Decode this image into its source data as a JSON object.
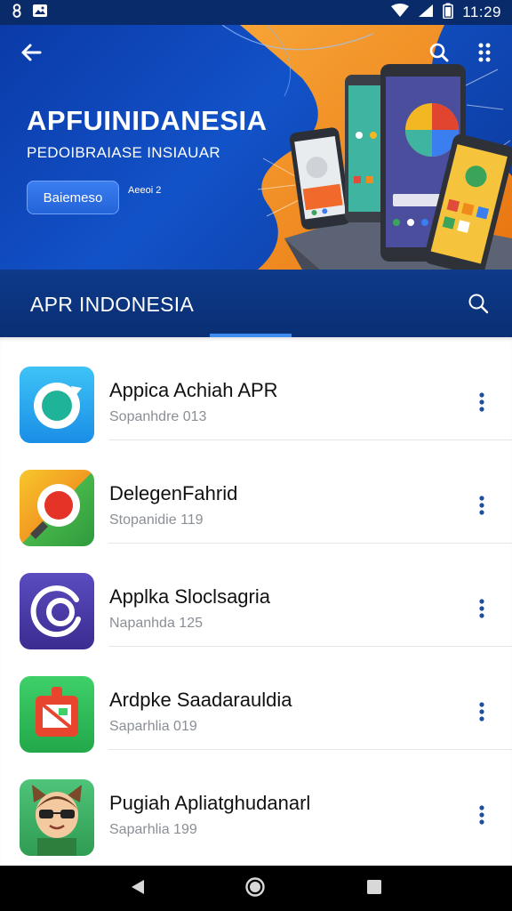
{
  "status_bar": {
    "time": "11:29",
    "left_icons": [
      "notification-8-icon",
      "image-notification-icon"
    ],
    "right_icons": [
      "wifi-icon",
      "signal-icon",
      "battery-icon"
    ]
  },
  "hero": {
    "title": "APFUINIDANESIA",
    "subtitle": "PEDOIBRAIASE INSIAUAR",
    "button_label": "Baiemeso",
    "small_text": "Aeeoi 2",
    "icons": [
      "back-arrow-icon",
      "search-icon",
      "grid-dots-icon"
    ],
    "colors": {
      "blue": "#1252c8",
      "orange": "#f08a1c"
    }
  },
  "section": {
    "title": "APR INDONESIA",
    "search_icon": "search-icon"
  },
  "apps": [
    {
      "name": "Appica Achiah APR",
      "subtitle": "Sopanhdre 013",
      "icon": "refresh-circle-app-icon",
      "color": "#2aa8f0"
    },
    {
      "name": "DelegenFahrid",
      "subtitle": "Stopanidie 119",
      "icon": "magnifier-app-icon",
      "color": "#f2b722"
    },
    {
      "name": "Applka Sloclsagria",
      "subtitle": "Napanhda 125",
      "icon": "spiral-app-icon",
      "color": "#4a3aa8"
    },
    {
      "name": "Ardpke Saadarauldia",
      "subtitle": "Saparhlia 019",
      "icon": "photo-app-icon",
      "color": "#2ec45a"
    },
    {
      "name": "Pugiah Apliatghudanarl",
      "subtitle": "Saparhlia 199",
      "icon": "cartoon-avatar-app-icon",
      "color": "#3cb56a"
    }
  ],
  "nav": {
    "icons": [
      "back-triangle-icon",
      "home-circle-icon",
      "recents-square-icon"
    ]
  }
}
